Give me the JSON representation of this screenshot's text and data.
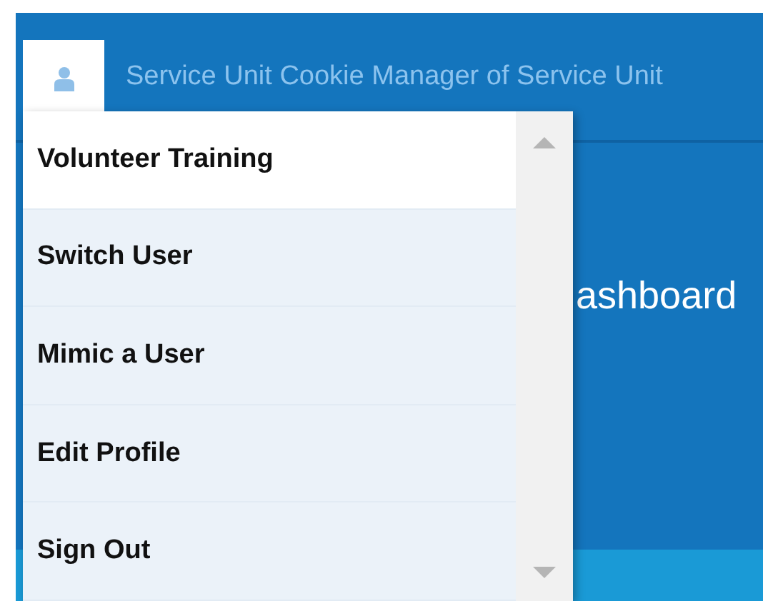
{
  "header": {
    "title": "Service Unit Cookie Manager of Service Unit"
  },
  "page": {
    "heading": "ashboard"
  },
  "user_menu": {
    "expanded": true,
    "items": [
      {
        "label": "Volunteer Training",
        "selected": true
      },
      {
        "label": "Switch User",
        "selected": false
      },
      {
        "label": "Mimic a User",
        "selected": false
      },
      {
        "label": "Edit Profile",
        "selected": false
      },
      {
        "label": "Sign Out",
        "selected": false
      }
    ]
  }
}
